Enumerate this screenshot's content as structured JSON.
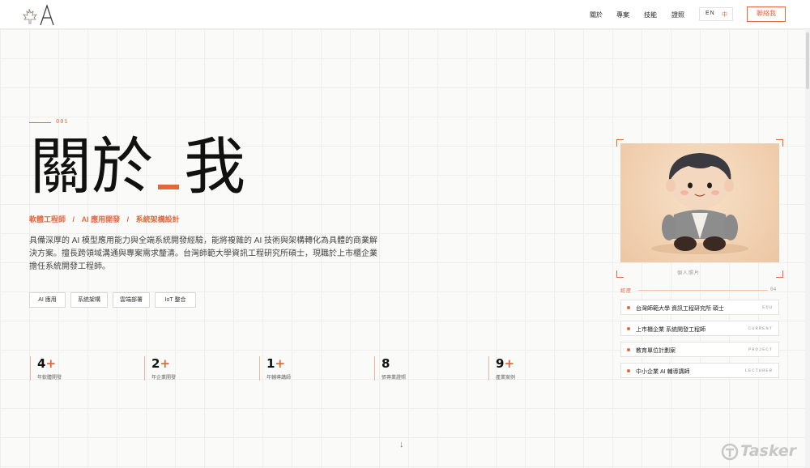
{
  "header": {
    "nav": [
      {
        "label": "關於"
      },
      {
        "label": "專案"
      },
      {
        "label": "技能"
      },
      {
        "label": "證照"
      }
    ],
    "lang": {
      "en": "EN",
      "zh": "中",
      "active": "中"
    },
    "contact_label": "聯絡我"
  },
  "hero": {
    "section_number": "001",
    "title_part1": "關於",
    "title_part2": "我",
    "roles": [
      "軟體工程師",
      "AI 應用開發",
      "系統架構設計"
    ],
    "role_separator": "/",
    "description": "具備深厚的 AI 模型應用能力與全端系統開發經驗，能將複雜的 AI 技術與架構轉化為具體的商業解決方案。擅長跨領域溝通與專案需求釐清。台灣師範大學資訊工程研究所碩士，現職於上市櫃企業擔任系統開發工程師。",
    "tags": [
      "AI 應用",
      "系統架構",
      "雲端部署",
      "IoT 整合"
    ]
  },
  "stats": [
    {
      "value": "4",
      "plus": "+",
      "label": "年軟體開發"
    },
    {
      "value": "2",
      "plus": "+",
      "label": "年企業開發"
    },
    {
      "value": "1",
      "plus": "+",
      "label": "年輔導講師"
    },
    {
      "value": "8",
      "plus": "",
      "label": "張專業證照"
    },
    {
      "value": "9",
      "plus": "+",
      "label": "產業案例"
    }
  ],
  "profile": {
    "photo_caption": "個人照片",
    "experience_label": "經歷",
    "experience_count": "04",
    "experience": [
      {
        "text": "台灣師範大學 資訊工程研究所 碩士",
        "tag": "EDU"
      },
      {
        "text": "上市櫃企業 系統開發工程師",
        "tag": "CURRENT"
      },
      {
        "text": "教育單位計劃案",
        "tag": "PROJECT"
      },
      {
        "text": "中小企業 AI 輔導講師",
        "tag": "LECTURER"
      }
    ]
  },
  "watermark": {
    "text": "Tasker"
  },
  "colors": {
    "accent": "#e4683f",
    "background": "#fafaf9",
    "text": "#1a1a1a"
  },
  "icons": {
    "logo": "maple-leaf-a-logo",
    "scroll": "arrow-down-icon",
    "watermark": "tasker-logo-icon"
  }
}
